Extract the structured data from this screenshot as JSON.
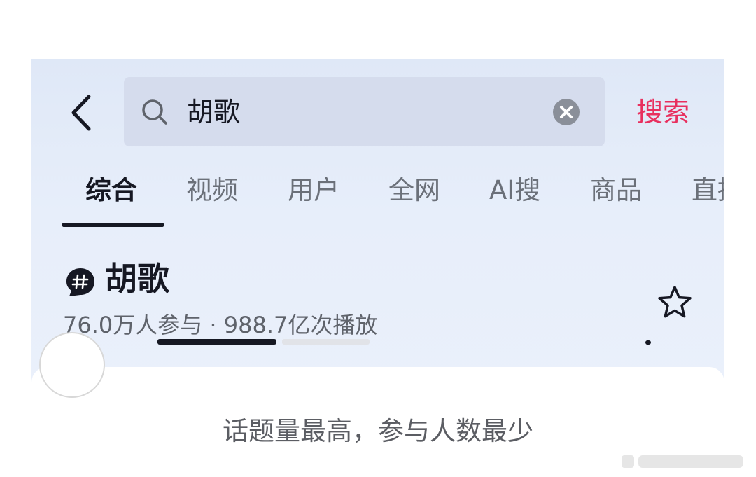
{
  "search": {
    "query": "胡歌",
    "button_label": "搜索"
  },
  "tabs": [
    {
      "label": "综合",
      "active": true
    },
    {
      "label": "视频",
      "active": false
    },
    {
      "label": "用户",
      "active": false
    },
    {
      "label": "全网",
      "active": false
    },
    {
      "label": "AI搜",
      "active": false
    },
    {
      "label": "商品",
      "active": false
    },
    {
      "label": "直播",
      "active": false
    }
  ],
  "topic": {
    "icon": "hashtag-icon",
    "title": "胡歌",
    "stats": "76.0万人参与 · 988.7亿次播放"
  },
  "caption": "话题量最高，参与人数最少",
  "colors": {
    "accent": "#e8305f",
    "background": "#e5ecf9",
    "text_primary": "#161823",
    "text_secondary": "#6b7079"
  }
}
